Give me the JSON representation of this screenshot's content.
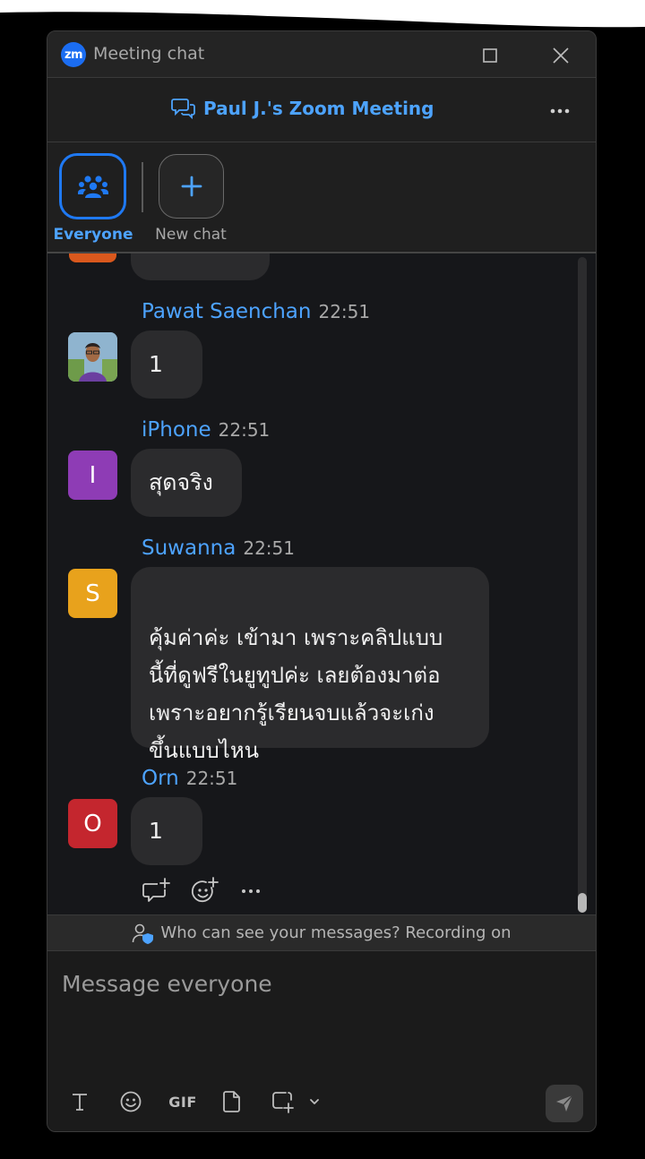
{
  "window": {
    "title": "Meeting chat"
  },
  "header": {
    "meeting_title": "Paul J.'s Zoom Meeting"
  },
  "tabs": [
    {
      "label": "Everyone",
      "active": true,
      "icon": "people-group-icon"
    },
    {
      "label": "New chat",
      "active": false,
      "icon": "plus-icon"
    }
  ],
  "messages": [
    {
      "sender": "Pawat Saenchan",
      "time": "22:51",
      "avatar": {
        "type": "photo"
      },
      "text": "1"
    },
    {
      "sender": "iPhone",
      "time": "22:51",
      "avatar": {
        "type": "letter",
        "letter": "I",
        "color": "#8e3cb5"
      },
      "text": "สุดจริง"
    },
    {
      "sender": "Suwanna",
      "time": "22:51",
      "avatar": {
        "type": "letter",
        "letter": "S",
        "color": "#e8a21c"
      },
      "text": "คุ้มค่าค่ะ เข้ามา เพราะคลิปแบบ\nนี้ที่ดูฟรีในยูทูปค่ะ เลยต้องมาต่อ\nเพราะอยากรู้เรียนจบแล้วจะเก่ง\nขึ้นแบบไหน"
    },
    {
      "sender": "Orn",
      "time": "22:51",
      "avatar": {
        "type": "letter",
        "letter": "O",
        "color": "#c4262e"
      },
      "text": "1"
    }
  ],
  "notice": {
    "text": "Who can see your messages? Recording on"
  },
  "composer": {
    "placeholder": "Message everyone",
    "gif_label": "GIF"
  },
  "colors": {
    "accent": "#4da3ff",
    "brand": "#1b6df2",
    "background": "#16171a"
  }
}
